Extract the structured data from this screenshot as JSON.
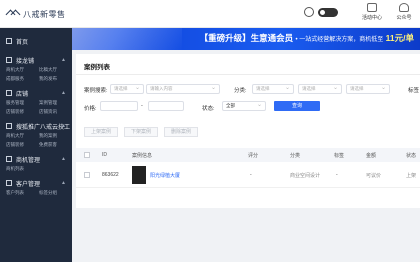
{
  "app": {
    "logo_text": "八戒新零售"
  },
  "topbar": {
    "tools": [
      {
        "label": "活动中心",
        "icon": "activity-center-icon"
      },
      {
        "label": "公众号",
        "icon": "person-icon"
      }
    ]
  },
  "sidebar": {
    "home": "首页",
    "sections": [
      {
        "title": "接龙铺",
        "items": [
          "商机大厅",
          "比稿大厅",
          "成都服务",
          "我的发布"
        ]
      },
      {
        "title": "店铺",
        "items": [
          "服务管理",
          "案例管理",
          "店铺装修",
          "店铺资讯"
        ]
      },
      {
        "title": "搜狐推广八戒云技工",
        "items": [
          "商机大厅",
          "我的案例",
          "店铺装修",
          "免费获客"
        ]
      },
      {
        "title": "商机管理",
        "items": [
          "商机列表"
        ]
      },
      {
        "title": "客户管理",
        "items": [
          "客户列表",
          "标签分组"
        ]
      }
    ]
  },
  "banner": {
    "headline": "【重磅升级】生意通会员",
    "sub": "• 一站式经营解决方案，商机低至",
    "price": "11元/单"
  },
  "panel": {
    "title": "案例列表",
    "filters": {
      "search_label": "案例搜索:",
      "search_select": "请选择",
      "search_placeholder": "请输入内容",
      "category_label": "分类:",
      "category_selects": [
        "请选择",
        "请选择",
        "请选择"
      ],
      "tag_label": "标签",
      "price_label": "价格:",
      "price_sep": "-",
      "status_label": "状态:",
      "status_value": "全部",
      "search_button": "查询"
    },
    "actions": [
      "上架案例",
      "下架案例",
      "删除案例"
    ],
    "columns": [
      "ID",
      "案例信息",
      "评分",
      "分类",
      "标签",
      "金额",
      "状态"
    ],
    "rows": [
      {
        "id": "863622",
        "title": "阳光绿植大厦",
        "rating": "-",
        "category": "商业空间设计",
        "tag": "-",
        "amount": "可议价",
        "status": "上架"
      }
    ]
  }
}
